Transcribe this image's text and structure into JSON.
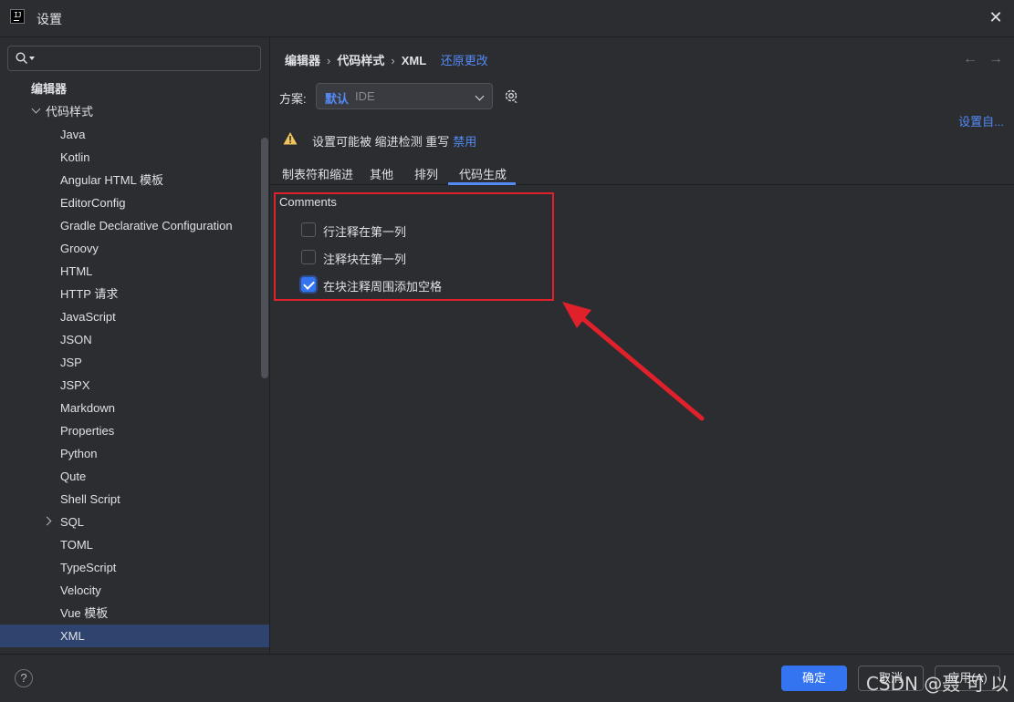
{
  "window": {
    "title": "设置",
    "logo": "IJ"
  },
  "search": {
    "placeholder": ""
  },
  "sidebar": {
    "items": [
      {
        "label": "编辑器",
        "level": 0,
        "bold": true
      },
      {
        "label": "代码样式",
        "level": 1,
        "expanded": true
      },
      {
        "label": "Java",
        "level": 2
      },
      {
        "label": "Kotlin",
        "level": 2
      },
      {
        "label": "Angular HTML 模板",
        "level": 2
      },
      {
        "label": "EditorConfig",
        "level": 2
      },
      {
        "label": "Gradle Declarative Configuration",
        "level": 2
      },
      {
        "label": "Groovy",
        "level": 2
      },
      {
        "label": "HTML",
        "level": 2
      },
      {
        "label": "HTTP 请求",
        "level": 2
      },
      {
        "label": "JavaScript",
        "level": 2
      },
      {
        "label": "JSON",
        "level": 2
      },
      {
        "label": "JSP",
        "level": 2
      },
      {
        "label": "JSPX",
        "level": 2
      },
      {
        "label": "Markdown",
        "level": 2
      },
      {
        "label": "Properties",
        "level": 2
      },
      {
        "label": "Python",
        "level": 2
      },
      {
        "label": "Qute",
        "level": 2
      },
      {
        "label": "Shell Script",
        "level": 2
      },
      {
        "label": "SQL",
        "level": 2,
        "collapsed": true
      },
      {
        "label": "TOML",
        "level": 2
      },
      {
        "label": "TypeScript",
        "level": 2
      },
      {
        "label": "Velocity",
        "level": 2
      },
      {
        "label": "Vue 模板",
        "level": 2
      },
      {
        "label": "XML",
        "level": 2,
        "selected": true
      }
    ]
  },
  "breadcrumb": {
    "items": [
      "编辑器",
      "代码样式",
      "XML"
    ],
    "reset_link": "还原更改"
  },
  "scheme": {
    "label": "方案:",
    "value": "默认",
    "sub": "IDE"
  },
  "set_from_link": "设置自...",
  "warning": {
    "text": "设置可能被 缩进检测 重写",
    "link": "禁用"
  },
  "tabs": [
    "制表符和缩进",
    "其他",
    "排列",
    "代码生成"
  ],
  "active_tab": "代码生成",
  "comments": {
    "title": "Comments",
    "options": [
      {
        "label": "行注释在第一列",
        "checked": false
      },
      {
        "label": "注释块在第一列",
        "checked": false
      },
      {
        "label": "在块注释周围添加空格",
        "checked": true
      }
    ]
  },
  "footer": {
    "help": "?",
    "ok": "确定",
    "cancel": "取消",
    "apply": "应用(A)"
  },
  "watermark": "CSDN @聂 可 以",
  "colors": {
    "accent": "#548af7",
    "primary_button": "#3574f0",
    "annotation": "#e0202a",
    "selection": "#2e436e"
  }
}
